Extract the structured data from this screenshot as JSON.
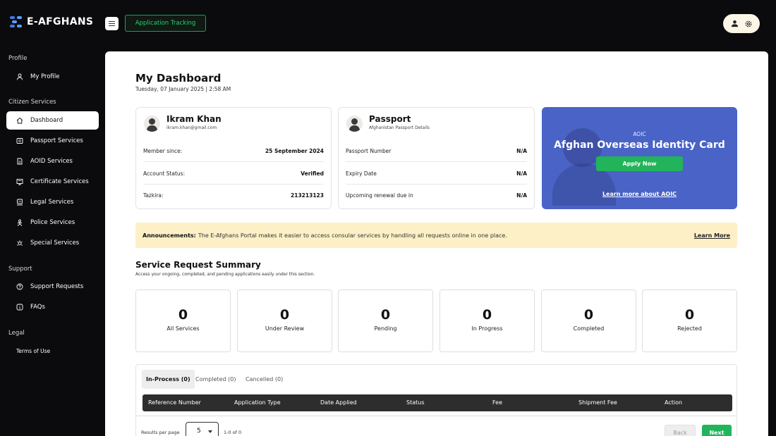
{
  "header": {
    "brand": "E-AFGHANS",
    "tracking_button": "Application Tracking",
    "menu_icon": "hamburger-icon",
    "user_icon": "user-icon",
    "settings_icon": "gear-icon"
  },
  "sidebar": {
    "sections": [
      {
        "heading": "Profile",
        "items": [
          {
            "label": "My Profile",
            "icon": "user-icon"
          }
        ]
      },
      {
        "heading": "Citizen Services",
        "items": [
          {
            "label": "Dashboard",
            "icon": "home-icon",
            "active": true
          },
          {
            "label": "Passport Services",
            "icon": "passport-icon"
          },
          {
            "label": "AOID Services",
            "icon": "document-icon"
          },
          {
            "label": "Certificate Services",
            "icon": "certificate-icon"
          },
          {
            "label": "Legal Services",
            "icon": "legal-icon"
          },
          {
            "label": "Police Services",
            "icon": "police-icon"
          },
          {
            "label": "Special Services",
            "icon": "special-icon"
          }
        ]
      },
      {
        "heading": "Support",
        "items": [
          {
            "label": "Support Requests",
            "icon": "help-icon"
          },
          {
            "label": "FAQs",
            "icon": "info-icon"
          }
        ]
      },
      {
        "heading": "Legal",
        "items": [
          {
            "label": "Terms of Use"
          }
        ]
      }
    ]
  },
  "dashboard": {
    "title": "My Dashboard",
    "datetime": "Tuesday, 07 January 2025 | 2:58 AM"
  },
  "profile_card": {
    "name": "Ikram Khan",
    "email": "ikram.khan@gmail.com",
    "rows": [
      {
        "label": "Member since:",
        "value": "25 September 2024"
      },
      {
        "label": "Account Status:",
        "value": "Verified"
      },
      {
        "label": "Tazkira:",
        "value": "213213123"
      }
    ]
  },
  "passport_card": {
    "title": "Passport",
    "subtitle": "Afghanistan Passport Details",
    "rows": [
      {
        "label": "Passport Number",
        "value": "N/A"
      },
      {
        "label": "Expiry Date",
        "value": "N/A"
      },
      {
        "label": "Upcoming renewal due in",
        "value": "N/A"
      }
    ]
  },
  "promo": {
    "tag": "AOIC",
    "title": "Afghan Overseas Identity Card",
    "apply": "Apply Now",
    "learn": "Learn more about AOIC"
  },
  "announcement": {
    "label": "Announcements:",
    "text": "The E-Afghans Portal makes it easier to access consular services by handling all requests online in one place.",
    "link": "Learn More"
  },
  "summary": {
    "title": "Service Request Summary",
    "subtitle": "Access your ongoing, completed, and pending applications easily under this section.",
    "stats": [
      {
        "value": "0",
        "label": "All Services"
      },
      {
        "value": "0",
        "label": "Under Review"
      },
      {
        "value": "0",
        "label": "Pending"
      },
      {
        "value": "0",
        "label": "In Progress"
      },
      {
        "value": "0",
        "label": "Completed"
      },
      {
        "value": "0",
        "label": "Rejected"
      }
    ]
  },
  "requests": {
    "tabs": [
      {
        "label": "In-Process (0)",
        "active": true
      },
      {
        "label": "Completed (0)"
      },
      {
        "label": "Cancelled (0)"
      }
    ],
    "columns": [
      "Reference Number",
      "Application Type",
      "Date Applied",
      "Status",
      "Fee",
      "Shipment Fee",
      "Action"
    ],
    "results_per_page_label": "Results per page",
    "results_per_page": "5",
    "range": "1-0 of 0",
    "back": "Back",
    "next": "Next"
  },
  "colors": {
    "accent_green": "#22b45a",
    "promo_blue": "#4a63c6",
    "announce_bg": "#fdf0c6",
    "sidebar_bg": "#0b0b0d"
  }
}
